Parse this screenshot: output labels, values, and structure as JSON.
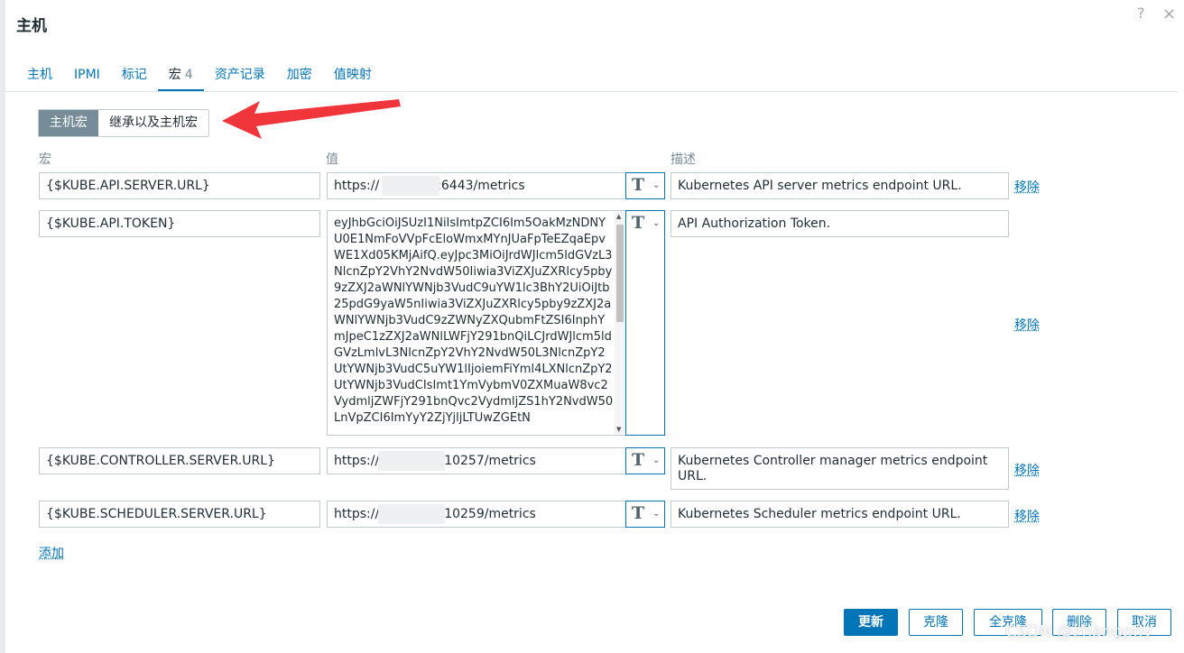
{
  "dialog": {
    "title": "主机",
    "help": "?",
    "close": "×"
  },
  "tabs": [
    {
      "label": "主机"
    },
    {
      "label": "IPMI"
    },
    {
      "label": "标记"
    },
    {
      "label": "宏",
      "count": "4"
    },
    {
      "label": "资产记录"
    },
    {
      "label": "加密"
    },
    {
      "label": "值映射"
    }
  ],
  "macro_view": {
    "host_macros": "主机宏",
    "inherited_macros": "继承以及主机宏"
  },
  "columns": {
    "macro": "宏",
    "value": "值",
    "description": "描述"
  },
  "rows": [
    {
      "macro": "{$KUBE.API.SERVER.URL}",
      "value_prefix": "https://",
      "value_suffix": ":6443/metrics",
      "description": "Kubernetes API server metrics endpoint URL.",
      "remove": "移除"
    },
    {
      "macro": "{$KUBE.API.TOKEN}",
      "value": "eyJhbGciOiJSUzI1NiIsImtpZCI6Im5OakMzNDNYU0E1NmFoVVpFcEloWmxMYnJUaFpTeEZqaEpvWE1Xd05KMjAifQ.eyJpc3MiOiJrdWJlcm5ldGVzL3NlcnZpY2VhY2NvdW50Iiwia3ViZXJuZXRlcy5pby9zZXJ2aWNlYWNjb3VudC9uYW1lc3BhY2UiOiJtb25pdG9yaW5nIiwia3ViZXJuZXRlcy5pby9zZXJ2aWNlYWNjb3VudC9zZWNyZXQubmFtZSI6InphYmJpeC1zZXJ2aWNlLWFjY291bnQiLCJrdWJlcm5ldGVzLmlvL3NlcnZpY2VhY2NvdW50L3NlcnZpY2UtYWNjb3VudC5uYW1lIjoiemFiYml4LXNlcnZpY2UtYWNjb3VudCIsImt1YmVybmV0ZXMuaW8vc2VydmljZWFjY291bnQvc2VydmljZS1hY2NvdW50LnVpZCI6ImYyY2ZjYjljLTUwZGEtN",
      "description": "API Authorization Token.",
      "remove": "移除"
    },
    {
      "macro": "{$KUBE.CONTROLLER.SERVER.URL}",
      "value_prefix": "https://",
      "value_suffix": "10257/metrics",
      "description": "Kubernetes Controller manager metrics endpoint URL.",
      "remove": "移除"
    },
    {
      "macro": "{$KUBE.SCHEDULER.SERVER.URL}",
      "value_prefix": "https://",
      "value_suffix": "10259/metrics",
      "description": "Kubernetes Scheduler metrics endpoint URL.",
      "remove": "移除"
    }
  ],
  "type_selector": {
    "glyph": "T",
    "chevron": "⌄"
  },
  "add_link": "添加",
  "footer": {
    "update": "更新",
    "clone": "克隆",
    "full_clone": "全克隆",
    "delete": "删除",
    "cancel": "取消"
  },
  "watermark": "CSDN @zhangpfly",
  "colors": {
    "accent": "#0275b8",
    "segment_active": "#768d99",
    "arrow": "#f0353b"
  }
}
